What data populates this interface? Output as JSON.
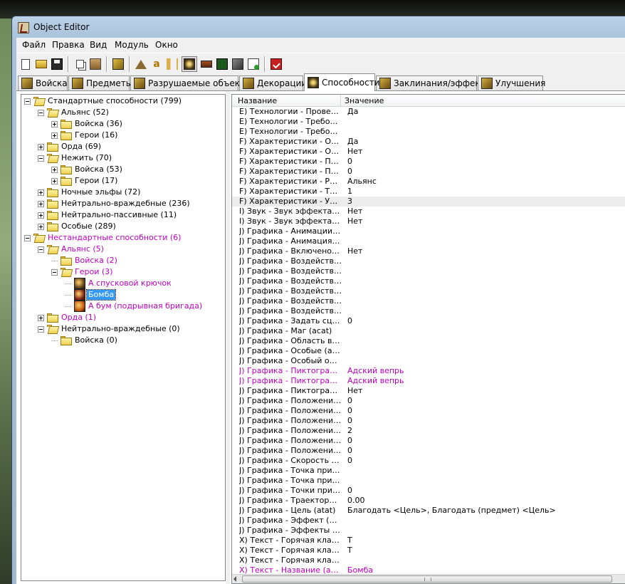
{
  "window": {
    "title": "Object Editor"
  },
  "menu": [
    "Файл",
    "Правка",
    "Вид",
    "Модуль",
    "Окно"
  ],
  "toolbar": {
    "buttons": [
      "new-icon",
      "open-icon",
      "save-icon",
      "copy-icon",
      "paste-icon",
      "custom-object-icon",
      "terrain-icon",
      "text-icon",
      "sound-icon",
      "ability-icon",
      "unit-icon",
      "map-icon",
      "import-icon",
      "export-icon",
      "validate-icon"
    ],
    "active_button": "ability-icon"
  },
  "tabs": [
    {
      "label": "Войска",
      "icon": "unit-tab-icon"
    },
    {
      "label": "Предметы",
      "icon": "item-tab-icon"
    },
    {
      "label": "Разрушаемые объекты",
      "icon": "destructible-tab-icon"
    },
    {
      "label": "Декорации",
      "icon": "doodad-tab-icon"
    },
    {
      "label": "Способности",
      "icon": "ability-tab-icon",
      "active": true
    },
    {
      "label": "Заклинания/эффекты",
      "icon": "buff-tab-icon"
    },
    {
      "label": "Улучшения",
      "icon": "upgrade-tab-icon"
    }
  ],
  "tree": [
    {
      "label": "Стандартные способности (799)",
      "level": 0,
      "exp": "minus",
      "icon": "folder-open",
      "custom": false
    },
    {
      "label": "Альянс (52)",
      "level": 1,
      "exp": "minus",
      "icon": "folder-open",
      "custom": false
    },
    {
      "label": "Войска (36)",
      "level": 2,
      "exp": "plus",
      "icon": "folder",
      "custom": false
    },
    {
      "label": "Герои (16)",
      "level": 2,
      "exp": "plus",
      "icon": "folder",
      "custom": false
    },
    {
      "label": "Орда (69)",
      "level": 1,
      "exp": "plus",
      "icon": "folder",
      "custom": false
    },
    {
      "label": "Нежить (70)",
      "level": 1,
      "exp": "minus",
      "icon": "folder-open",
      "custom": false
    },
    {
      "label": "Войска (53)",
      "level": 2,
      "exp": "plus",
      "icon": "folder",
      "custom": false
    },
    {
      "label": "Герои (17)",
      "level": 2,
      "exp": "plus",
      "icon": "folder",
      "custom": false
    },
    {
      "label": "Ночные эльфы (72)",
      "level": 1,
      "exp": "plus",
      "icon": "folder",
      "custom": false
    },
    {
      "label": "Нейтрально-враждебные (236)",
      "level": 1,
      "exp": "plus",
      "icon": "folder",
      "custom": false
    },
    {
      "label": "Нейтрально-пассивные (11)",
      "level": 1,
      "exp": "plus",
      "icon": "folder",
      "custom": false
    },
    {
      "label": "Особые (289)",
      "level": 1,
      "exp": "plus",
      "icon": "folder",
      "custom": false
    },
    {
      "label": "Нестандартные способности (6)",
      "level": 0,
      "exp": "minus",
      "icon": "folder-open",
      "custom": true
    },
    {
      "label": "Альянс (5)",
      "level": 1,
      "exp": "minus",
      "icon": "folder-open",
      "custom": true
    },
    {
      "label": "Войска (2)",
      "level": 2,
      "exp": "none",
      "icon": "folder",
      "custom": true
    },
    {
      "label": "Герои (3)",
      "level": 2,
      "exp": "minus",
      "icon": "folder-open",
      "custom": true
    },
    {
      "label": "А спусковой крючок",
      "level": 3,
      "exp": "none",
      "icon": "ability-object",
      "custom": true,
      "color": "#6a4a22"
    },
    {
      "label": "Бомба",
      "level": 3,
      "exp": "none",
      "icon": "ability-object",
      "custom": true,
      "selected": true,
      "color": "#8a2a1a"
    },
    {
      "label": "А бум (подрывная бригада)",
      "level": 3,
      "exp": "none",
      "icon": "ability-object",
      "custom": true,
      "color": "#c85a10"
    },
    {
      "label": "Орда (1)",
      "level": 1,
      "exp": "plus",
      "icon": "folder",
      "custom": true
    },
    {
      "label": "Нейтрально-враждебные (0)",
      "level": 1,
      "exp": "minus",
      "icon": "folder-open",
      "custom": false
    },
    {
      "label": "Войска (0)",
      "level": 2,
      "exp": "none",
      "icon": "folder",
      "custom": false
    }
  ],
  "grid": {
    "headers": [
      "Название",
      "Значение"
    ],
    "rows": [
      {
        "name": "E) Технологии - Проверят...",
        "value": "Да"
      },
      {
        "name": "E) Технологии - Требован...",
        "value": ""
      },
      {
        "name": "E) Технологии - Требован...",
        "value": ""
      },
      {
        "name": "F) Характеристики - Относ...",
        "value": "Да"
      },
      {
        "name": "F) Характеристики - Относ...",
        "value": "Нет"
      },
      {
        "name": "F) Характеристики - Прио...",
        "value": "0"
      },
      {
        "name": "F) Характеристики - Пропу...",
        "value": "0"
      },
      {
        "name": "F) Характеристики - Раса (...",
        "value": "Альянс"
      },
      {
        "name": "F) Характеристики - Требу...",
        "value": "1"
      },
      {
        "name": "F) Характеристики - Уров...",
        "value": "3",
        "highlight": true
      },
      {
        "name": "I) Звук - Звук эффекта (aefs)",
        "value": "Нет"
      },
      {
        "name": "I) Звук - Звук эффекта (по...",
        "value": "Нет"
      },
      {
        "name": "J) Графика - Анимации (aani)",
        "value": ""
      },
      {
        "name": "J) Графика - Анимация ди...",
        "value": ""
      },
      {
        "name": "J) Графика - Включено авт...",
        "value": "Нет"
      },
      {
        "name": "J) Графика - Воздействие ...",
        "value": ""
      },
      {
        "name": "J) Графика - Воздействие ...",
        "value": ""
      },
      {
        "name": "J) Графика - Воздействие ...",
        "value": ""
      },
      {
        "name": "J) Графика - Воздействие ...",
        "value": ""
      },
      {
        "name": "J) Графика - Воздействие ...",
        "value": ""
      },
      {
        "name": "J) Графика - Воздействие ...",
        "value": ""
      },
      {
        "name": "J) Графика - Задать сцена...",
        "value": "0"
      },
      {
        "name": "J) Графика - Маг (acat)",
        "value": ""
      },
      {
        "name": "J) Графика - Область возд...",
        "value": ""
      },
      {
        "name": "J) Графика - Особые (asat)",
        "value": ""
      },
      {
        "name": "J) Графика - Особый объе...",
        "value": ""
      },
      {
        "name": "J) Графика - Пиктограмма...",
        "value": "Адский вепрь",
        "custom": true
      },
      {
        "name": "J) Графика - Пиктограмма...",
        "value": "Адский вепрь",
        "custom": true
      },
      {
        "name": "J) Графика - Пиктограмма...",
        "value": "Нет"
      },
      {
        "name": "J) Графика - Положение к...",
        "value": "0"
      },
      {
        "name": "J) Графика - Положение к...",
        "value": "0"
      },
      {
        "name": "J) Графика - Положение к...",
        "value": "0"
      },
      {
        "name": "J) Графика - Положение к...",
        "value": "2"
      },
      {
        "name": "J) Графика - Положение к...",
        "value": "0"
      },
      {
        "name": "J) Графика - Положение к...",
        "value": "0"
      },
      {
        "name": "J) Графика - Скорость дис...",
        "value": "0"
      },
      {
        "name": "J) Графика - Точка прилож...",
        "value": ""
      },
      {
        "name": "J) Графика - Точка прилож...",
        "value": ""
      },
      {
        "name": "J) Графика - Точки прилож...",
        "value": "0"
      },
      {
        "name": "J) Графика - Траектория р...",
        "value": "0.00"
      },
      {
        "name": "J) Графика - Цель (atat)",
        "value": "Благодать <Цель>, Благодать (предмет) <Цель>"
      },
      {
        "name": "J) Графика - Эффект (aeat)",
        "value": ""
      },
      {
        "name": "J) Графика - Эффекты мол...",
        "value": ""
      },
      {
        "name": "X) Текст - Горячая клавиш...",
        "value": "T"
      },
      {
        "name": "X) Текст - Горячая клавиш...",
        "value": "T"
      },
      {
        "name": "X) Текст - Горячая клавиш...",
        "value": ""
      },
      {
        "name": "X) Текст - Название (anam)",
        "value": "Бомба",
        "custom": true
      }
    ]
  },
  "colors": {
    "custom_text": "#c000c0",
    "selection": "#3399ff",
    "folder": "#f0d050"
  }
}
